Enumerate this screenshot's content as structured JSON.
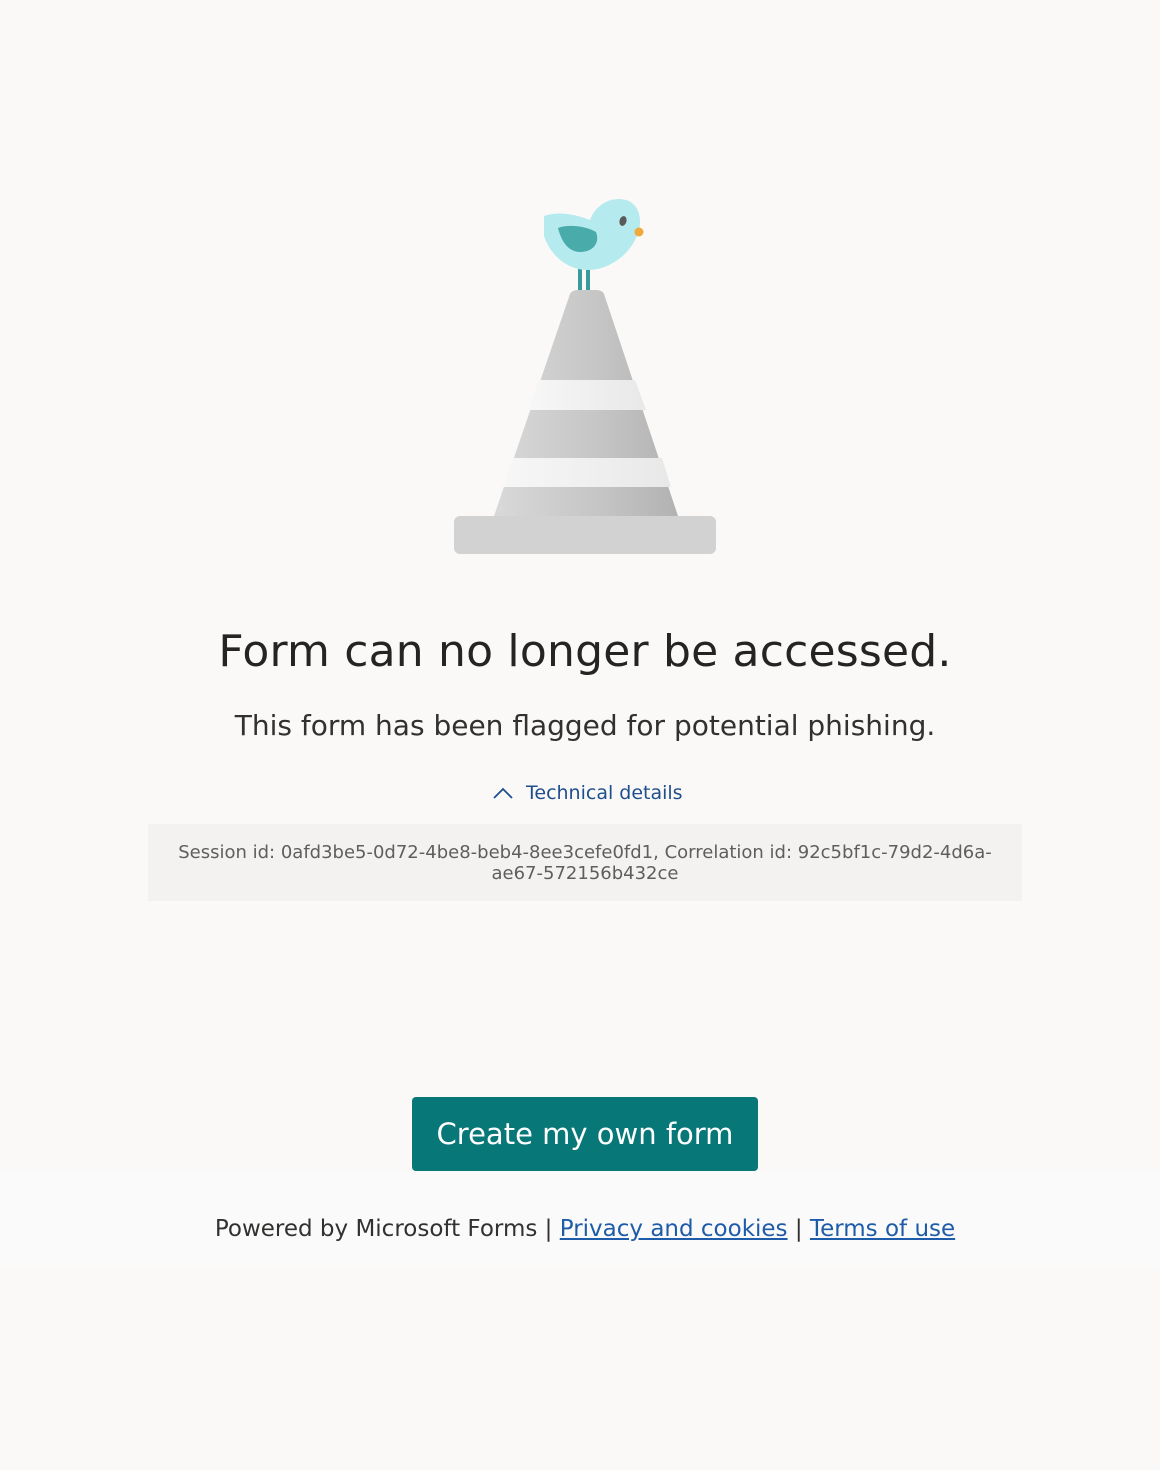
{
  "error": {
    "title": "Form can no longer be accessed.",
    "subtitle": "This form has been flagged for potential phishing."
  },
  "technical_details": {
    "toggle_label": "Technical details",
    "expanded": true,
    "icon": "chevron-up-icon",
    "text": "Session id: 0afd3be5-0d72-4be8-beb4-8ee3cefe0fd1, Correlation id: 92c5bf1c-79d2-4d6a-ae67-572156b432ce"
  },
  "actions": {
    "create_label": "Create my own form"
  },
  "footer": {
    "powered_by": "Powered by Microsoft Forms",
    "separator": "|",
    "privacy_label": "Privacy and cookies",
    "terms_label": "Terms of use"
  },
  "illustration": {
    "icon": "bird-on-traffic-cone-icon"
  },
  "colors": {
    "page_background": "#faf9f8",
    "button_background": "#077777",
    "link": "#1e5ba8",
    "details_background": "#f3f2f1"
  }
}
